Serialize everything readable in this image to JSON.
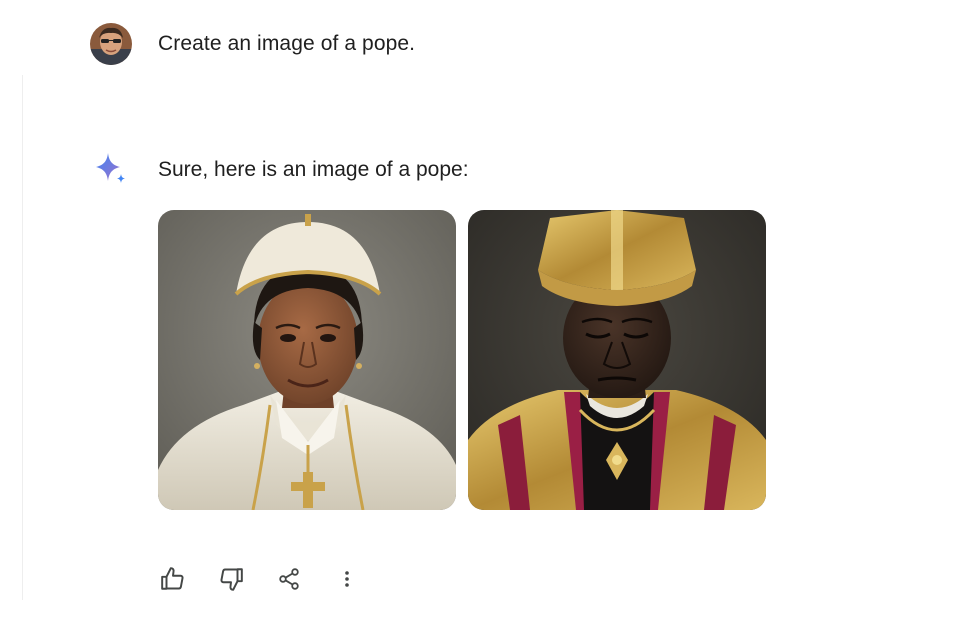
{
  "conversation": {
    "user_prompt": "Create an image of a pope.",
    "model_response": "Sure, here is an image of a pope:"
  },
  "images": [
    {
      "icon": "generated-image-pope-1"
    },
    {
      "icon": "generated-image-pope-2"
    }
  ],
  "actions": {
    "thumbs_up": "thumbs-up-icon",
    "thumbs_down": "thumbs-down-icon",
    "share": "share-icon",
    "more": "more-vert-icon"
  },
  "colors": {
    "text": "#1f1f1f",
    "icon": "#444746",
    "spark_blue": "#4285f4",
    "spark_purple": "#9b72cb"
  }
}
